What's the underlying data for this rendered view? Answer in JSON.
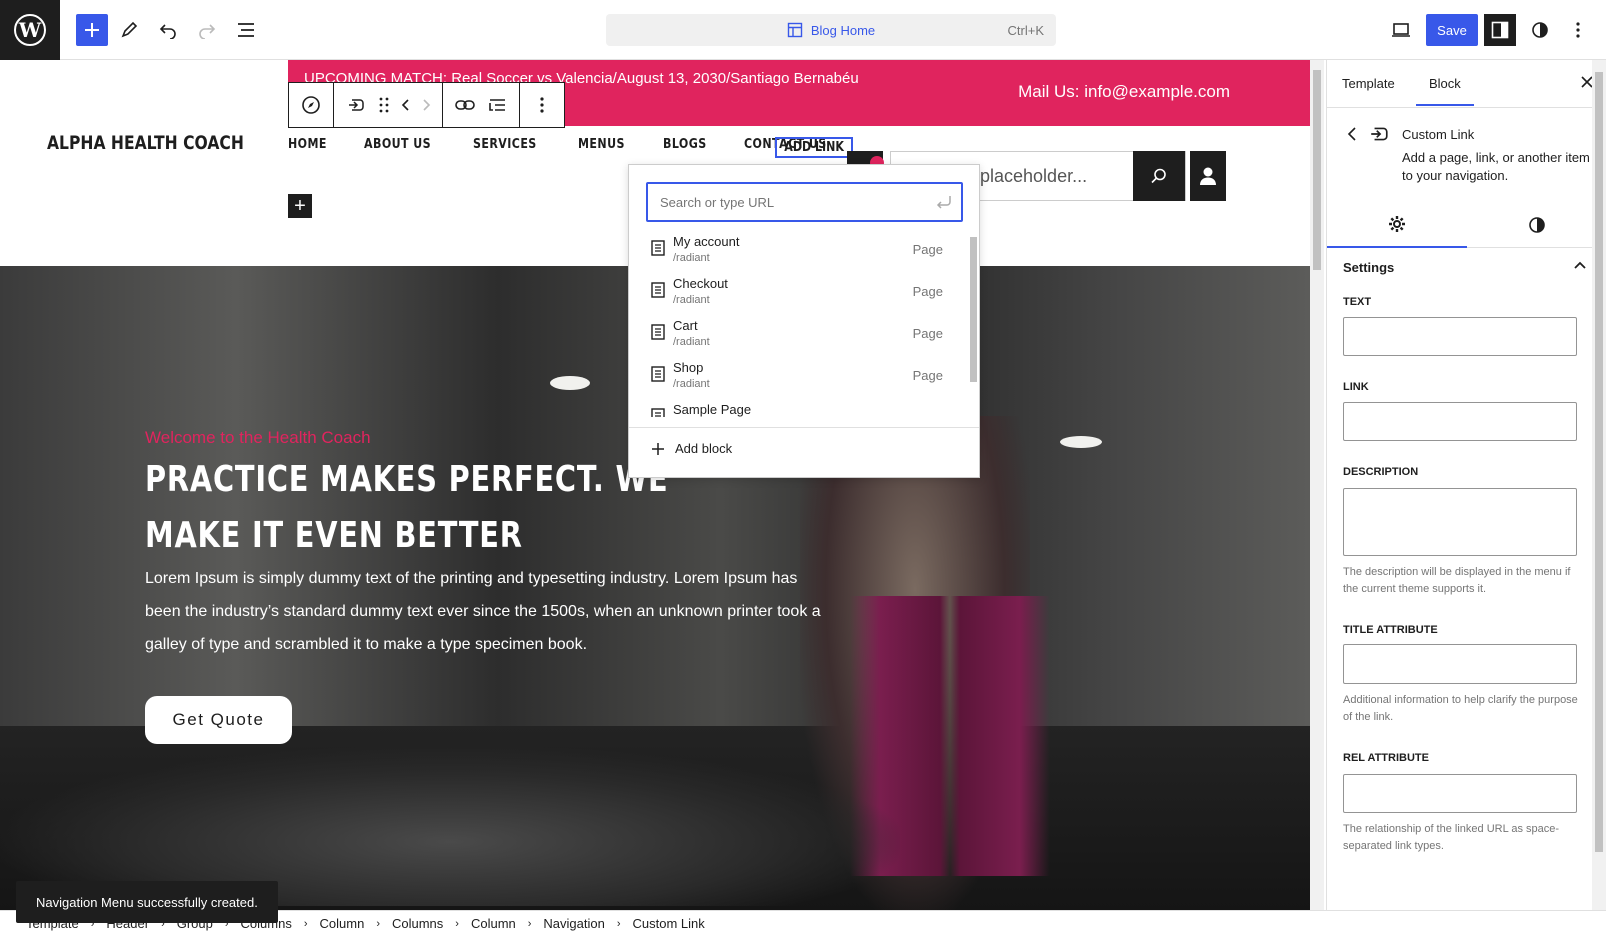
{
  "topbar": {
    "command": {
      "label": "Blog Home",
      "shortcut": "Ctrl+K"
    },
    "save_label": "Save"
  },
  "site": {
    "ticker": "UPCOMING MATCH: Real Soccer vs Valencia/August 13, 2030/Santiago Bernabéu",
    "mail": "Mail Us: info@example.com",
    "logo": "ALPHA HEALTH COACH",
    "nav": [
      "HOME",
      "ABOUT US",
      "SERVICES",
      "MENUS",
      "BLOGS",
      "CONTACT US"
    ],
    "nav_add": "ADD LINK",
    "search_placeholder": "l placeholder..."
  },
  "hero": {
    "subtitle": "Welcome to the Health Coach",
    "title": "PRACTICE MAKES PERFECT. WE MAKE IT EVEN BETTER",
    "paragraph": "Lorem Ipsum is simply dummy text of the printing and typesetting industry. Lorem Ipsum has been the industry’s standard dummy text ever since the 1500s, when an unknown printer took a galley of type and scrambled it to make a type specimen book.",
    "button": "Get Quote"
  },
  "link_popover": {
    "placeholder": "Search or type URL",
    "suggestions": [
      {
        "title": "My account",
        "url": "/radiant",
        "kind": "Page"
      },
      {
        "title": "Checkout",
        "url": "/radiant",
        "kind": "Page"
      },
      {
        "title": "Cart",
        "url": "/radiant",
        "kind": "Page"
      },
      {
        "title": "Shop",
        "url": "/radiant",
        "kind": "Page"
      },
      {
        "title": "Sample Page",
        "url": "",
        "kind": ""
      }
    ],
    "add_block": "Add block"
  },
  "sidebar": {
    "tabs": [
      "Template",
      "Block"
    ],
    "block_title": "Custom Link",
    "block_desc": "Add a page, link, or another item to your navigation.",
    "settings_title": "Settings",
    "fields": {
      "text": "TEXT",
      "link": "LINK",
      "description": "DESCRIPTION",
      "description_help": "The description will be displayed in the menu if the current theme supports it.",
      "title_attr": "TITLE ATTRIBUTE",
      "title_help": "Additional information to help clarify the purpose of the link.",
      "rel_attr": "REL ATTRIBUTE",
      "rel_help": "The relationship of the linked URL as space-separated link types."
    }
  },
  "breadcrumbs": [
    "Template",
    "Header",
    "Group",
    "Columns",
    "Column",
    "Columns",
    "Column",
    "Navigation",
    "Custom Link"
  ],
  "snackbar": "Navigation Menu successfully created.",
  "colors": {
    "accent": "#3858e9",
    "brand": "#e0245e",
    "dark": "#1e1e1e"
  }
}
